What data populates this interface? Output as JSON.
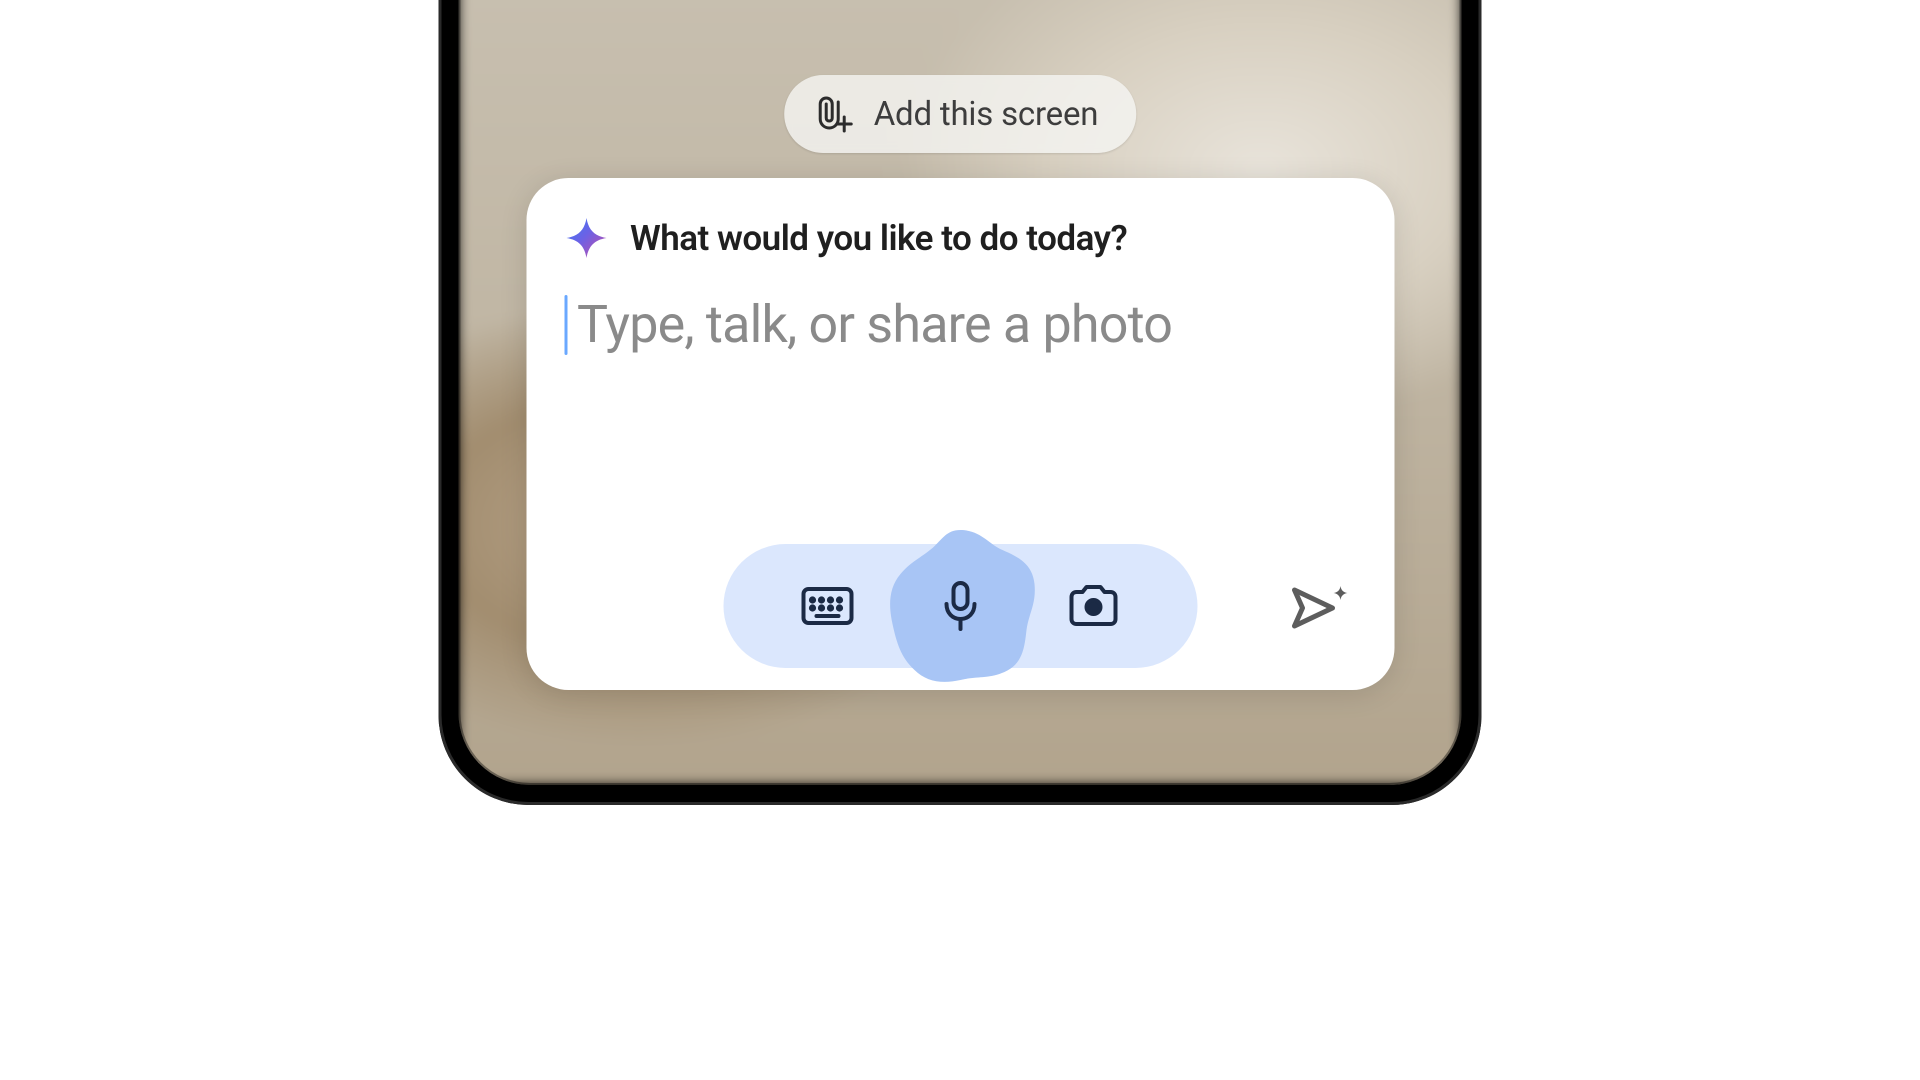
{
  "chip": {
    "label": "Add this screen",
    "icon": "paperclip-plus-icon"
  },
  "card": {
    "title": "What would you like to do today?",
    "placeholder": "Type, talk, or share a photo",
    "sparkle_icon": "gemini-sparkle-icon"
  },
  "controls": {
    "keyboard": "keyboard-icon",
    "mic": "microphone-icon",
    "camera": "camera-icon",
    "send": "send-sparkle-icon"
  },
  "colors": {
    "tray_bg": "#dbe7fd",
    "mic_blob": "#a8c5f5",
    "caret": "#6aa8ff"
  }
}
